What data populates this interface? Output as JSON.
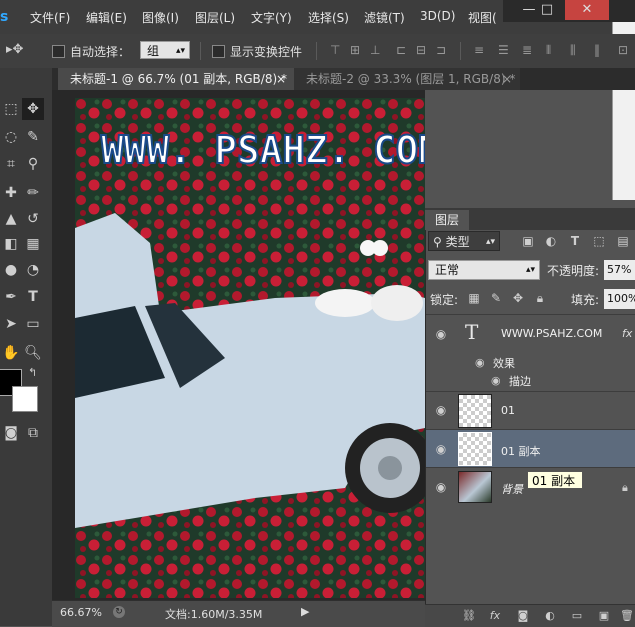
{
  "app": {
    "logo": "s"
  },
  "menu": [
    "文件(F)",
    "编辑(E)",
    "图像(I)",
    "图层(L)",
    "文字(Y)",
    "选择(S)",
    "滤镜(T)",
    "3D(D)",
    "视图("
  ],
  "window_controls": {
    "minimize": "—",
    "maximize": "□",
    "close": "✕"
  },
  "options_bar": {
    "auto_select_label": "自动选择：",
    "auto_select_value": "组",
    "show_transform_label": "显示变换控件"
  },
  "tabs": [
    {
      "label": "未标题-1 @ 66.7% (01 副本, RGB/8) *",
      "close": "×"
    },
    {
      "label": "未标题-2 @ 33.3% (图层 1, RGB/8) *",
      "close": "×"
    }
  ],
  "canvas": {
    "watermark_text": "WWW. PSAHZ. COM"
  },
  "status": {
    "zoom": "66.67%",
    "doc_info": "文档:1.60M/3.35M"
  },
  "layers_panel": {
    "title": "图层",
    "kind_filter": "类型",
    "blend_mode": "正常",
    "opacity_label": "不透明度:",
    "opacity_value": "57%",
    "lock_label": "锁定:",
    "fill_label": "填充:",
    "fill_value": "100%",
    "layers": [
      {
        "name": "WWW.PSAHZ.COM",
        "kind": "text",
        "fx": "fx"
      },
      {
        "effects_label": "效果",
        "stroke_label": "描边"
      },
      {
        "name": "01",
        "kind": "pixel"
      },
      {
        "name": "01 副本",
        "kind": "pixel",
        "selected": true
      },
      {
        "name": "背景",
        "kind": "image",
        "locked": true
      }
    ],
    "tooltip": "01 副本"
  },
  "colors": {
    "accent": "#31a8ff",
    "selected_row": "#5d6b7d",
    "watermark": "#ffffff"
  }
}
